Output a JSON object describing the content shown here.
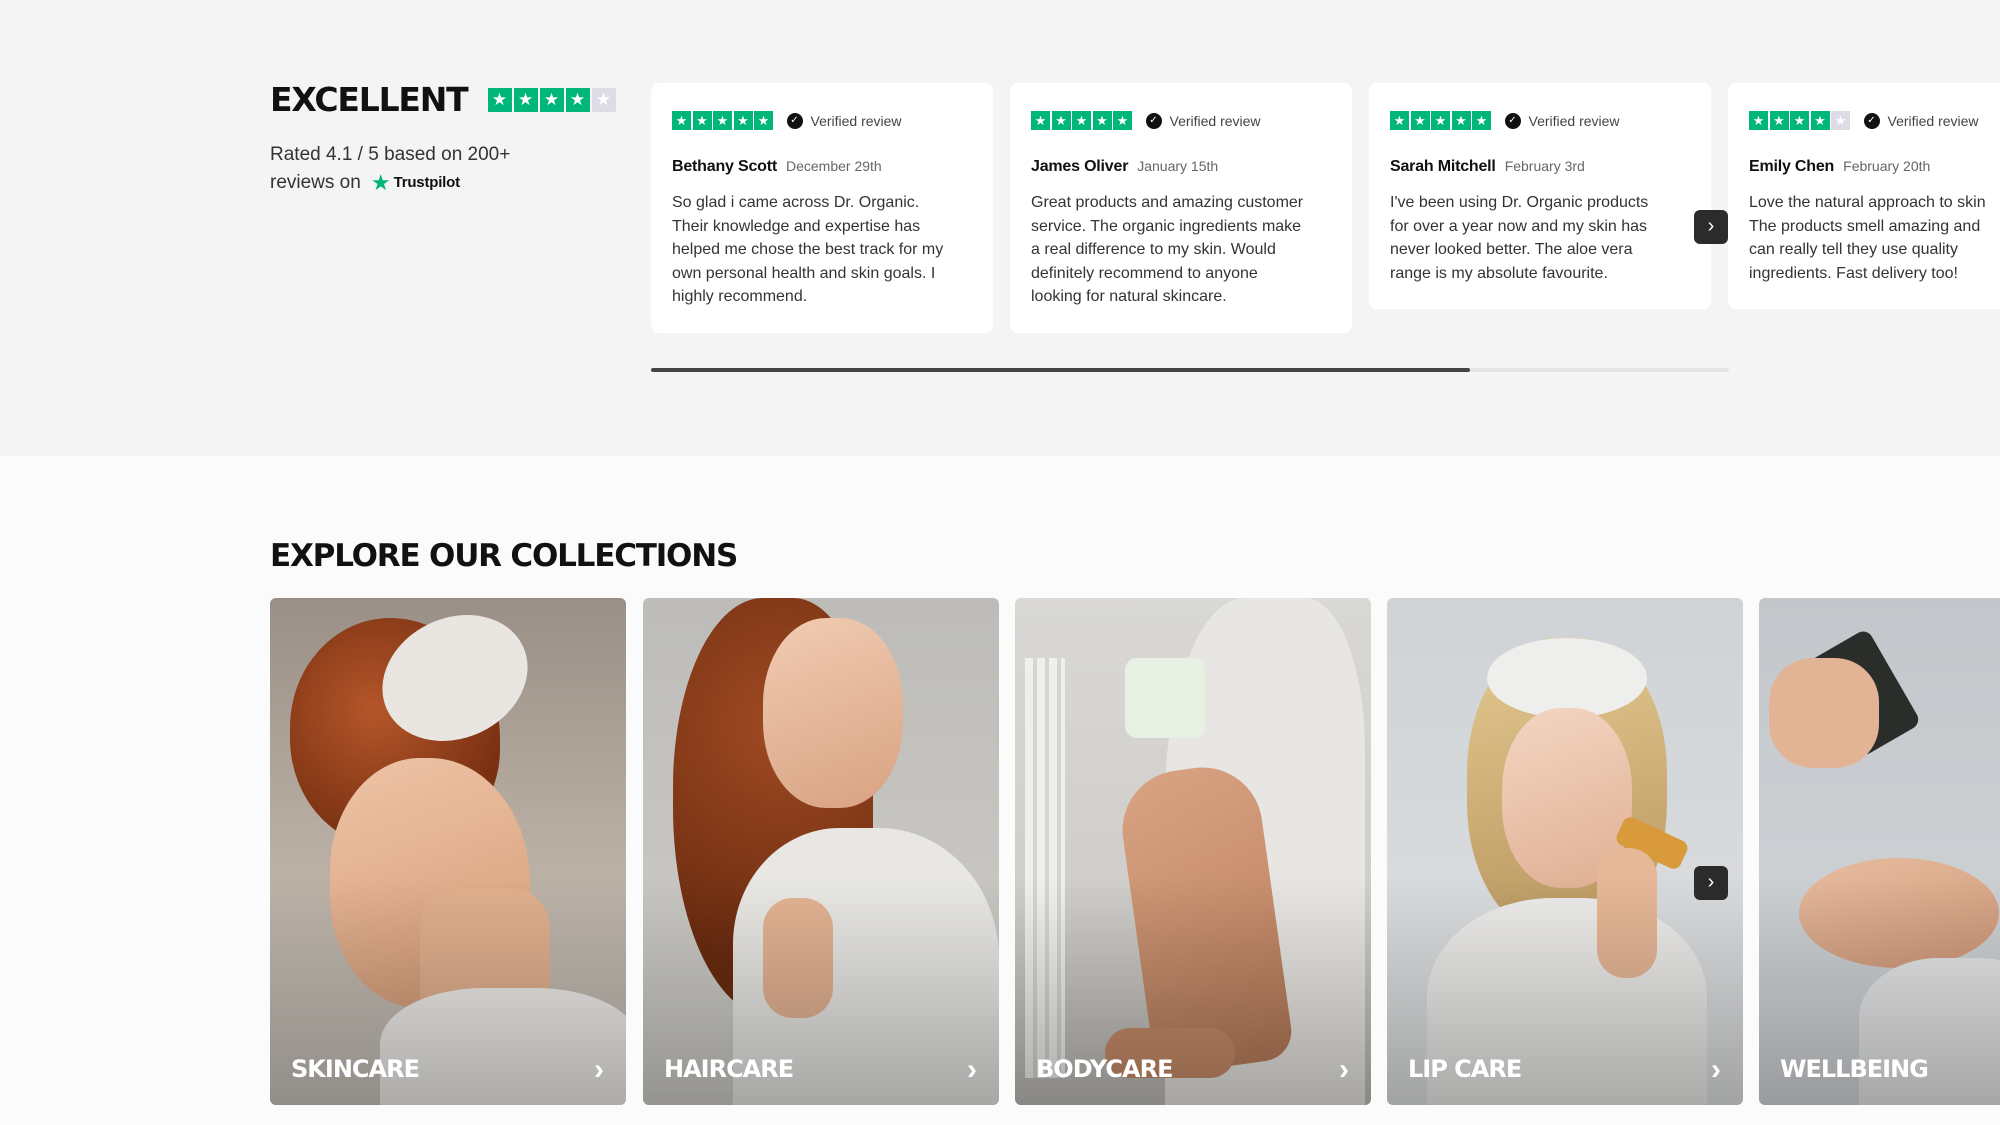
{
  "summary": {
    "heading": "EXCELLENT",
    "rating_stars": 4.1,
    "rated_line1": "Rated 4.1 / 5 based on 200+",
    "rated_line2": "reviews on",
    "trustpilot_label": "Trustpilot"
  },
  "reviews": [
    {
      "stars": 5,
      "verified": "Verified review",
      "author": "Bethany Scott",
      "date": "December 29th",
      "lines": [
        "So glad i came across Dr. Organic.",
        "Their knowledge and expertise has",
        "helped me chose the best track for my",
        "own personal health and skin goals. I",
        "highly recommend."
      ]
    },
    {
      "stars": 5,
      "verified": "Verified review",
      "author": "James Oliver",
      "date": "January 15th",
      "lines": [
        "Great products and amazing customer",
        "service. The organic ingredients make",
        "a real difference to my skin. Would",
        "definitely recommend to anyone",
        "looking for natural skincare."
      ]
    },
    {
      "stars": 5,
      "verified": "Verified review",
      "author": "Sarah Mitchell",
      "date": "February 3rd",
      "lines": [
        "I've been using Dr. Organic products",
        "for over a year now and my skin has",
        "never looked better. The aloe vera",
        "range is my absolute favourite."
      ]
    },
    {
      "stars": 4,
      "verified": "Verified review",
      "author": "Emily Chen",
      "date": "February 20th",
      "lines": [
        "Love the natural approach to skin",
        "The products smell amazing and",
        "can really tell they use quality",
        "ingredients. Fast delivery too!"
      ]
    }
  ],
  "reviews_progress": 0.76,
  "collections": {
    "title": "EXPLORE OUR COLLECTIONS",
    "items": [
      {
        "label": "SKINCARE"
      },
      {
        "label": "HAIRCARE"
      },
      {
        "label": "BODYCARE"
      },
      {
        "label": "LIP CARE"
      },
      {
        "label": "WELLBEING"
      }
    ]
  },
  "icons": {
    "star": "star-icon",
    "verified": "verified-check-icon",
    "next": "chevron-right-icon",
    "trustpilot": "trustpilot-star-icon"
  },
  "colors": {
    "trustpilot_green": "#00b67a",
    "button_dark": "#2b2b2b"
  }
}
